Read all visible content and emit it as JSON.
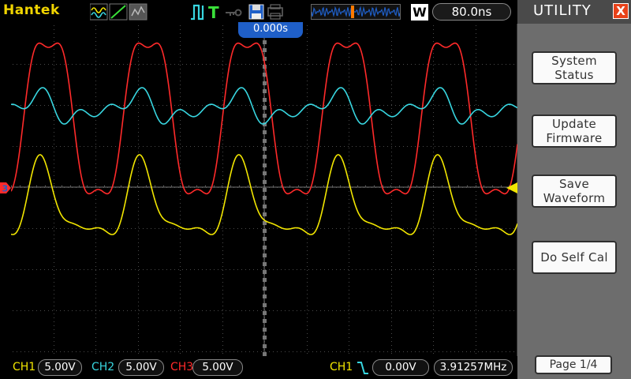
{
  "brand": "Hantek",
  "top": {
    "trigger_letter": "T",
    "w_label": "W",
    "timebase": "80.0ns",
    "trigger_time": "0.000s"
  },
  "channels": [
    {
      "label": "CH1",
      "scale": "5.00V",
      "color": "#f2e600"
    },
    {
      "label": "CH2",
      "scale": "5.00V",
      "color": "#38d6e0"
    },
    {
      "label": "CH3",
      "scale": "5.00V",
      "color": "#ff2a2a"
    }
  ],
  "trigger": {
    "source": "CH1",
    "level": "0.00V",
    "frequency": "3.91257MHz"
  },
  "marker_ch3": "3",
  "menu": {
    "title": "UTILITY",
    "close": "X",
    "items": [
      {
        "line1": "System",
        "line2": "Status"
      },
      {
        "line1": "Update",
        "line2": "Firmware"
      },
      {
        "line1": "Save",
        "line2": "Waveform"
      },
      {
        "line1": "Do Self Cal",
        "line2": ""
      }
    ],
    "page": "Page 1/4"
  },
  "colors": {
    "ch1": "#f2e600",
    "ch2": "#38d6e0",
    "ch3": "#ff2a2a",
    "accent_blue": "#1f5fc8",
    "menu_bg": "#6d6d6d"
  }
}
